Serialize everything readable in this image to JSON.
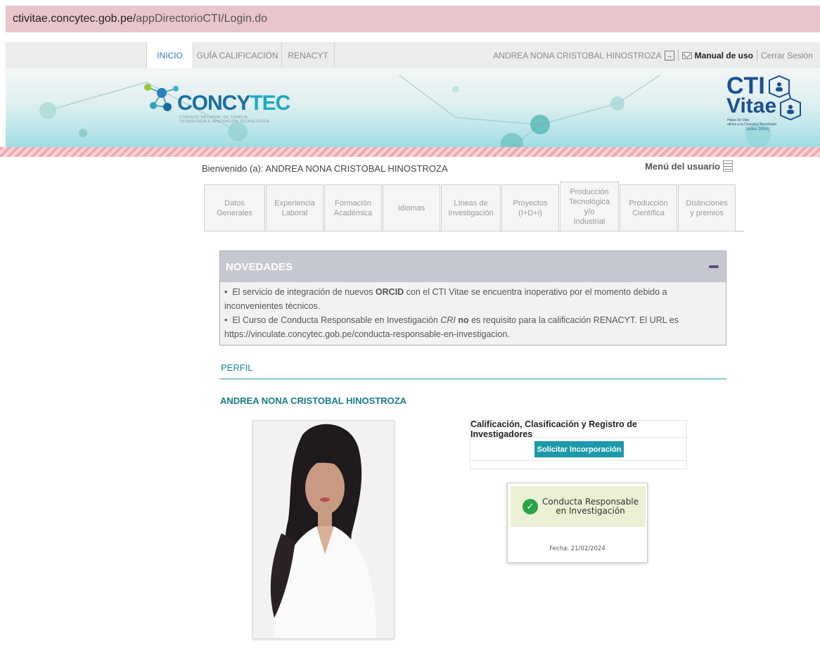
{
  "browser": {
    "url_host": "ctivitae.concytec.gob.pe/",
    "url_path": "appDirectorioCTI/Login.do"
  },
  "topnav": {
    "tabs": [
      {
        "label": "INICIO",
        "active": true
      },
      {
        "label": "GUÍA CALIFICACIÓN",
        "active": false
      },
      {
        "label": "RENACYT",
        "active": false
      }
    ],
    "user_name": "ANDREA NONA CRISTOBAL HINOSTROZA",
    "manual_label": "Manual de uso",
    "logout_label": "Cerrar Sesión"
  },
  "banner": {
    "concytec_main": "CONCY",
    "concytec_tec": "TEC",
    "concytec_sub1": "CONSEJO NACIONAL DE CIENCIA,",
    "concytec_sub2": "TECNOLOGÍA E INNOVACIÓN TECNOLÓGICA",
    "cti_top": "CTI",
    "cti_bottom": "Vitae",
    "cti_tag1": "Hojas de Vida",
    "cti_tag2": "afines a la Ciencia y Tecnología",
    "cti_dina": "(antes DINA)"
  },
  "welcome": {
    "text": "Bienvenido (a): ANDREA NONA CRISTOBAL HINOSTROZA",
    "menu_label": "Menú del usuario"
  },
  "sections": [
    {
      "line1": "Datos",
      "line2": "Generales",
      "line3": "",
      "line4": ""
    },
    {
      "line1": "Experiencia",
      "line2": "Laboral",
      "line3": "",
      "line4": ""
    },
    {
      "line1": "Formación",
      "line2": "Académica",
      "line3": "",
      "line4": ""
    },
    {
      "line1": "Idiomas",
      "line2": "",
      "line3": "",
      "line4": ""
    },
    {
      "line1": "Líneas de",
      "line2": "Investigación",
      "line3": "",
      "line4": ""
    },
    {
      "line1": "Proyectos",
      "line2": "(I+D+i)",
      "line3": "",
      "line4": ""
    },
    {
      "line1": "Producción",
      "line2": "Tecnológica",
      "line3": "y/o",
      "line4": "Industrial"
    },
    {
      "line1": "Producción",
      "line2": "Científica",
      "line3": "",
      "line4": ""
    },
    {
      "line1": "Distinciones",
      "line2": "y premios",
      "line3": "",
      "line4": ""
    }
  ],
  "novedades": {
    "title": "NOVEDADES",
    "item1_a": "El servicio de integración de nuevos ",
    "item1_bold": "ORCID",
    "item1_b": " con el CTI Vitae se encuentra inoperativo por el momento debido a inconvenientes técnicos.",
    "item2_a": "El Curso de Conducta Responsable en Investigación ",
    "item2_italic": "CRI",
    "item2_bold": " no",
    "item2_b": " es requisito para la calificación RENACYT. El URL es https://vinculate.concytec.gob.pe/conducta-responsable-en-investigacion."
  },
  "perfil": {
    "heading": "PERFIL",
    "name": "ANDREA NONA CRISTOBAL HINOSTROZA"
  },
  "calificacion": {
    "title": "Calificación, Clasificación y Registro de Investigadores",
    "button": "Solicitar Incorporación"
  },
  "conducta": {
    "line1": "Conducta Responsable",
    "line2": "en Investigación",
    "fecha": "Fecha: 21/02/2024"
  },
  "colors": {
    "accent": "#1a9aaa",
    "url_bar": "#e8c5cb",
    "brand_blue": "#1c4f8f"
  }
}
